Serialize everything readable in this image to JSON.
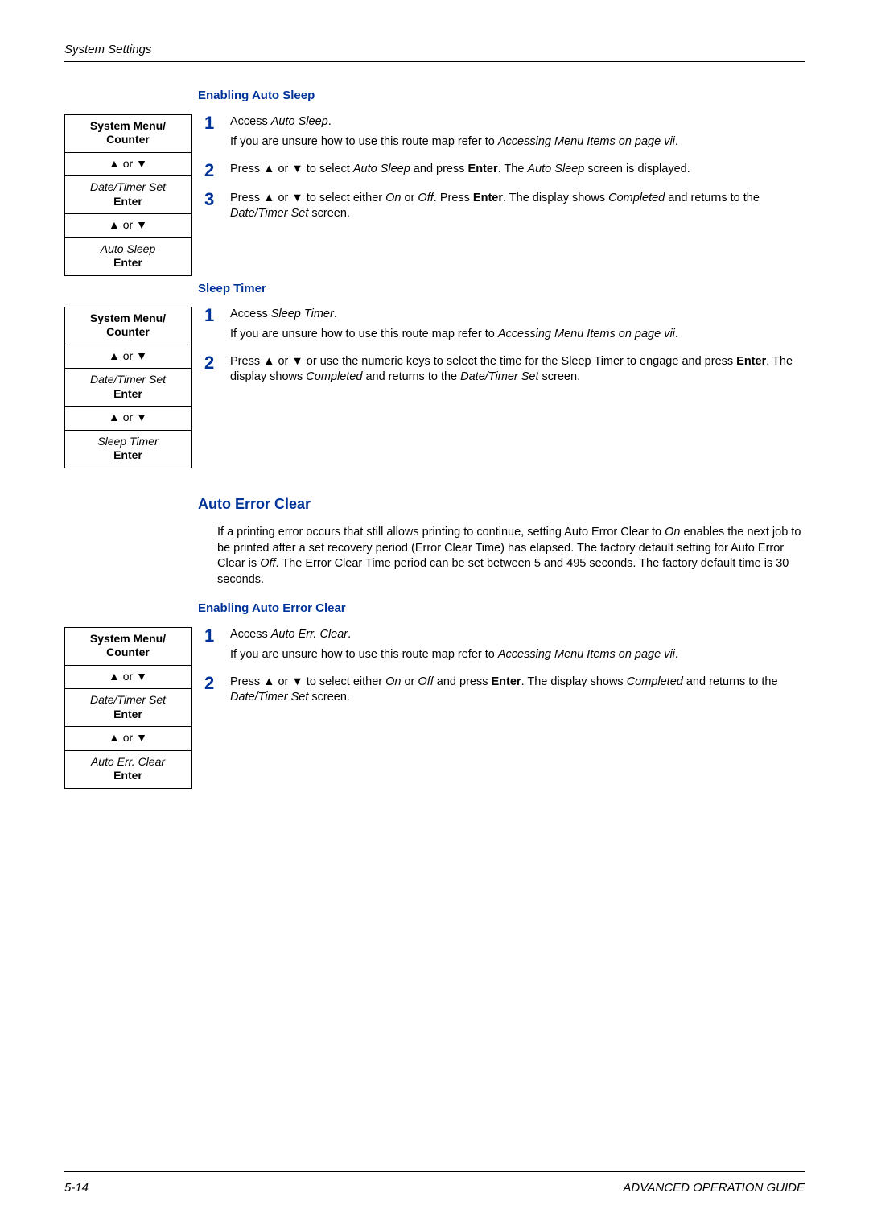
{
  "header": {
    "title": "System Settings"
  },
  "sections": [
    {
      "title": "Enabling Auto Sleep",
      "route": {
        "r1a": "System Menu/",
        "r1b": "Counter",
        "r2": "▲ or ▼",
        "r3a": "Date/Timer Set",
        "r3b": "Enter",
        "r4": "▲ or ▼",
        "r5a": "Auto Sleep",
        "r5b": "Enter"
      },
      "steps": [
        {
          "n": "1",
          "lines": [
            [
              {
                "t": "Access "
              },
              {
                "t": "Auto Sleep",
                "i": true
              },
              {
                "t": "."
              }
            ],
            [
              {
                "t": "If you are unsure how to use this route map refer to "
              },
              {
                "t": "Accessing Menu Items on page vii",
                "i": true
              },
              {
                "t": "."
              }
            ]
          ]
        },
        {
          "n": "2",
          "lines": [
            [
              {
                "t": "Press "
              },
              {
                "t": "▲",
                "a": true
              },
              {
                "t": " or "
              },
              {
                "t": "▼",
                "a": true
              },
              {
                "t": " to select "
              },
              {
                "t": "Auto Sleep",
                "i": true
              },
              {
                "t": " and press "
              },
              {
                "t": "Enter",
                "b": true
              },
              {
                "t": ". The "
              },
              {
                "t": "Auto Sleep",
                "i": true
              },
              {
                "t": " screen is displayed."
              }
            ]
          ]
        },
        {
          "n": "3",
          "lines": [
            [
              {
                "t": "Press "
              },
              {
                "t": "▲",
                "a": true
              },
              {
                "t": " or "
              },
              {
                "t": "▼",
                "a": true
              },
              {
                "t": " to select either "
              },
              {
                "t": "On",
                "i": true
              },
              {
                "t": " or "
              },
              {
                "t": "Off",
                "i": true
              },
              {
                "t": ". Press "
              },
              {
                "t": "Enter",
                "b": true
              },
              {
                "t": ". The display shows "
              },
              {
                "t": "Completed",
                "i": true
              },
              {
                "t": " and returns to the "
              },
              {
                "t": "Date/Timer Set",
                "i": true
              },
              {
                "t": " screen."
              }
            ]
          ]
        }
      ]
    },
    {
      "title": "Sleep Timer",
      "route": {
        "r1a": "System Menu/",
        "r1b": "Counter",
        "r2": "▲ or ▼",
        "r3a": "Date/Timer Set",
        "r3b": "Enter",
        "r4": "▲ or ▼",
        "r5a": "Sleep Timer",
        "r5b": "Enter"
      },
      "steps": [
        {
          "n": "1",
          "lines": [
            [
              {
                "t": "Access "
              },
              {
                "t": "Sleep Timer",
                "i": true
              },
              {
                "t": "."
              }
            ],
            [
              {
                "t": "If you are unsure how to use this route map refer to "
              },
              {
                "t": "Accessing Menu Items on page vii",
                "i": true
              },
              {
                "t": "."
              }
            ]
          ]
        },
        {
          "n": "2",
          "lines": [
            [
              {
                "t": "Press "
              },
              {
                "t": "▲",
                "a": true
              },
              {
                "t": " or "
              },
              {
                "t": "▼",
                "a": true
              },
              {
                "t": " or use the numeric keys to select the time for the Sleep Timer to engage and press "
              },
              {
                "t": "Enter",
                "b": true
              },
              {
                "t": ". The display shows "
              },
              {
                "t": "Completed",
                "i": true
              },
              {
                "t": " and returns to the "
              },
              {
                "t": "Date/Timer Set",
                "i": true
              },
              {
                "t": " screen."
              }
            ]
          ]
        }
      ]
    }
  ],
  "auto_error_clear": {
    "heading": "Auto Error Clear",
    "intro": [
      [
        {
          "t": "If a printing error occurs that still allows printing to continue, setting Auto Error Clear to "
        },
        {
          "t": "On",
          "i": true
        },
        {
          "t": " enables the next job to be printed after a set recovery period (Error Clear Time) has elapsed. The factory default setting for Auto Error Clear is "
        },
        {
          "t": "Off",
          "i": true
        },
        {
          "t": ". The Error Clear Time period can be set between 5 and 495 seconds. The factory default time is 30 seconds."
        }
      ]
    ],
    "subtitle": "Enabling Auto Error Clear",
    "route": {
      "r1a": "System Menu/",
      "r1b": "Counter",
      "r2": "▲ or ▼",
      "r3a": "Date/Timer Set",
      "r3b": "Enter",
      "r4": "▲ or ▼",
      "r5a": "Auto Err. Clear",
      "r5b": "Enter"
    },
    "steps": [
      {
        "n": "1",
        "lines": [
          [
            {
              "t": "Access "
            },
            {
              "t": "Auto Err. Clear",
              "i": true
            },
            {
              "t": "."
            }
          ],
          [
            {
              "t": "If you are unsure how to use this route map refer to "
            },
            {
              "t": "Accessing Menu Items on page vii",
              "i": true
            },
            {
              "t": "."
            }
          ]
        ]
      },
      {
        "n": "2",
        "lines": [
          [
            {
              "t": "Press "
            },
            {
              "t": "▲",
              "a": true
            },
            {
              "t": " or "
            },
            {
              "t": "▼",
              "a": true
            },
            {
              "t": " to select either "
            },
            {
              "t": "On",
              "i": true
            },
            {
              "t": " or "
            },
            {
              "t": "Off",
              "i": true
            },
            {
              "t": " and press "
            },
            {
              "t": "Enter",
              "b": true
            },
            {
              "t": ". The display shows "
            },
            {
              "t": "Completed",
              "i": true
            },
            {
              "t": " and returns to the "
            },
            {
              "t": "Date/Timer Set",
              "i": true
            },
            {
              "t": " screen."
            }
          ]
        ]
      }
    ]
  },
  "footer": {
    "page": "5-14",
    "book": "ADVANCED OPERATION GUIDE"
  }
}
